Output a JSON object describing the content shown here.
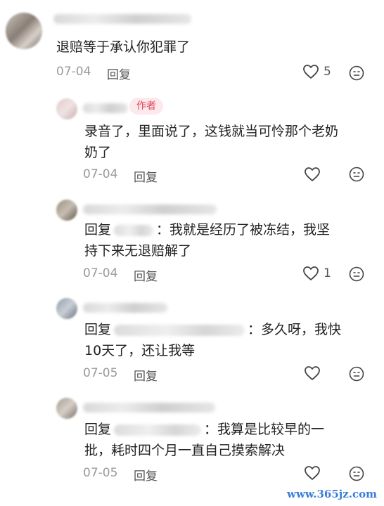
{
  "comments": [
    {
      "text": "退赔等于承认你犯罪了",
      "date": "07-04",
      "reply": "回复",
      "likes": "5"
    },
    {
      "tag": "作者",
      "text_line1": "录音了，里面说了，这钱就当可怜那个老奶",
      "text_line2": "奶了",
      "date": "07-04",
      "reply": "回复"
    },
    {
      "reply_prefix": "回复",
      "text_line1": "：我就是经历了被冻结，我坚",
      "text_line2": "持下来无退赔解了",
      "date": "07-04",
      "reply": "回复",
      "likes": "1"
    },
    {
      "reply_prefix": "回复",
      "text_line1": "：多久呀，我快",
      "text_line2": "10天了，还让我等",
      "date": "07-05",
      "reply": "回复"
    },
    {
      "reply_prefix": "回复",
      "text_line1": "：我算是比较早的一",
      "text_line2": "批，耗时四个月一直自己摸索解决",
      "date": "07-05",
      "reply": "回复"
    }
  ],
  "icons": {
    "like": "heart-outline-icon",
    "emoji": "neutral-face-icon"
  },
  "colors": {
    "author_tag_bg": "#fde9ec",
    "author_tag_text": "#e0485b",
    "meta": "#9a9a9a"
  },
  "watermark": "www.365jz.com"
}
